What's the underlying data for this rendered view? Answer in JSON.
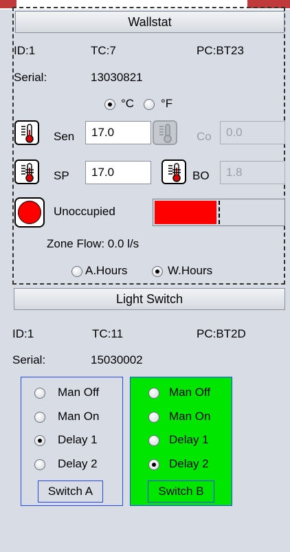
{
  "wallstat": {
    "header": "Wallstat",
    "id": "ID:1",
    "tc": "TC:7",
    "pc": "PC:BT23",
    "serial_label": "Serial:",
    "serial": "13030821",
    "unit_c": "°C",
    "unit_f": "°F",
    "sen_label": "Sen",
    "sen_value": "17.0",
    "co_label": "Co",
    "co_value": "0.0",
    "sp_label": "SP",
    "sp_value": "17.0",
    "bo_label": "BO",
    "bo_value": "1.8",
    "status_text": "Unoccupied",
    "status_color": "#ff0000",
    "zone_flow": "Zone Flow: 0.0 l/s",
    "a_hours": "A.Hours",
    "w_hours": "W.Hours"
  },
  "light_switch": {
    "header": "Light Switch",
    "id": "ID:1",
    "tc": "TC:11",
    "pc": "PC:BT2D",
    "serial_label": "Serial:",
    "serial": "15030002",
    "switch_a": {
      "label": "Switch A",
      "options": [
        "Man Off",
        "Man On",
        "Delay 1",
        "Delay 2"
      ],
      "selected": "Delay 1"
    },
    "switch_b": {
      "label": "Switch B",
      "options": [
        "Man Off",
        "Man On",
        "Delay 1",
        "Delay 2"
      ],
      "selected": "Delay 2",
      "background": "#00e600"
    }
  }
}
